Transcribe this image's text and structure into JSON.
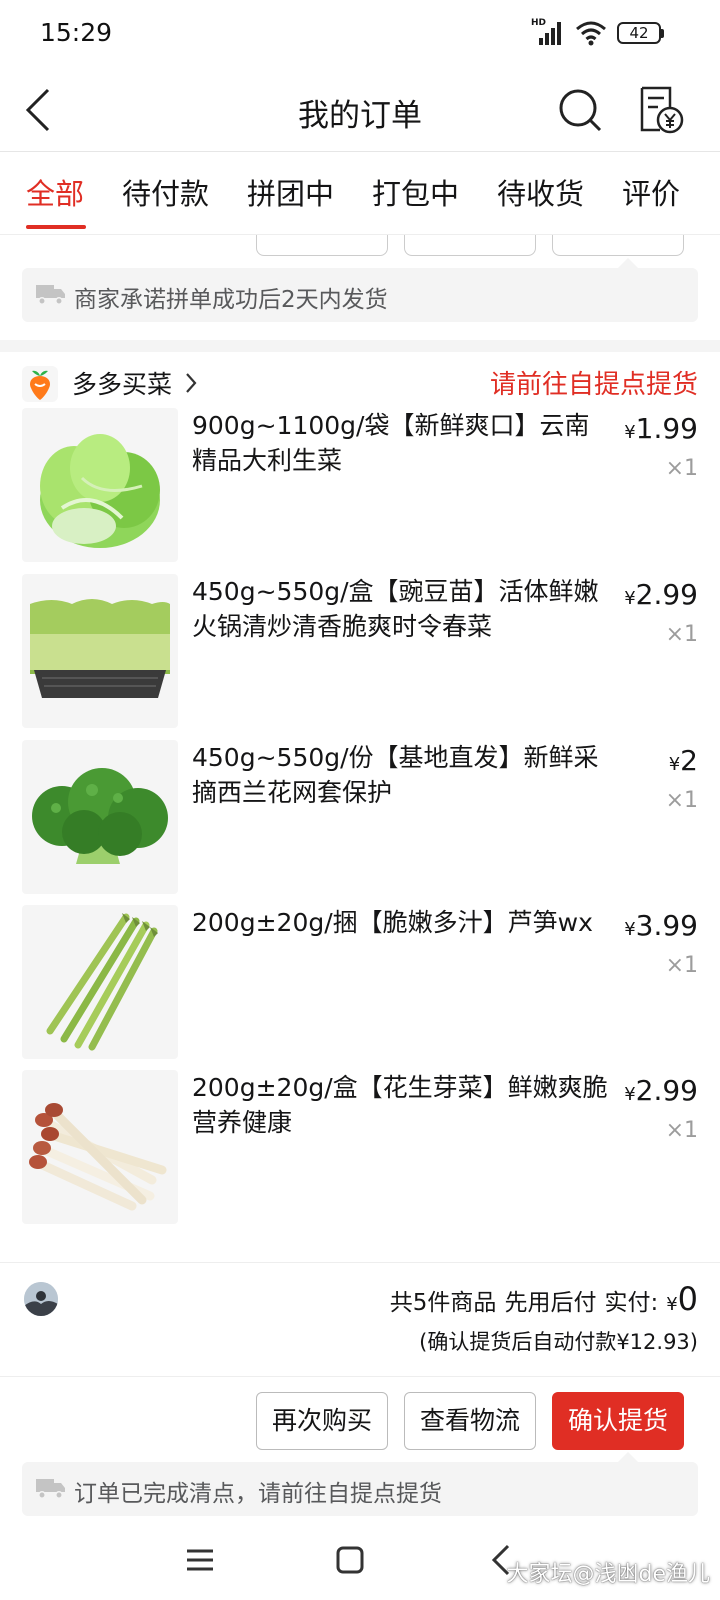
{
  "status_bar": {
    "time": "15:29",
    "network": "HD",
    "battery": "42"
  },
  "nav": {
    "title": "我的订单",
    "back_icon": "back-arrow-icon",
    "search_icon": "search-icon",
    "bill_icon": "bill-yen-icon"
  },
  "tabs": [
    "全部",
    "待付款",
    "拼团中",
    "打包中",
    "待收货",
    "评价"
  ],
  "active_tab": "全部",
  "accent_color": "#e02e24",
  "prev_order": {
    "notice": "商家承诺拼单成功后2天内发货"
  },
  "store": {
    "name": "多多买菜",
    "status": "请前往自提点提货"
  },
  "items": [
    {
      "title": "900g~1100g/袋【新鲜爽口】云南精品大利生菜",
      "currency": "¥",
      "price": "1.99",
      "qty": "×1"
    },
    {
      "title": "450g~550g/盒【豌豆苗】活体鲜嫩火锅清炒清香脆爽时令春菜",
      "currency": "¥",
      "price": "2.99",
      "qty": "×1"
    },
    {
      "title": "450g~550g/份【基地直发】新鲜采摘西兰花网套保护",
      "currency": "¥",
      "price": "2",
      "qty": "×1"
    },
    {
      "title": "200g±20g/捆【脆嫩多汁】芦笋wx",
      "currency": "¥",
      "price": "3.99",
      "qty": "×1"
    },
    {
      "title": "200g±20g/盒【花生芽菜】鲜嫩爽脆 营养健康",
      "currency": "¥",
      "price": "2.99",
      "qty": "×1"
    }
  ],
  "summary": {
    "count_text": "共5件商品",
    "pay_mode": "先用后付",
    "paid_label": "实付:",
    "currency": "¥",
    "paid_value": "0",
    "auto_pay_note": "(确认提货后自动付款¥12.93)"
  },
  "actions": {
    "rebuy": "再次购买",
    "logistics": "查看物流",
    "confirm": "确认提货"
  },
  "bottom_notice": "订单已完成清点，请前往自提点提货",
  "watermark": "大家坛@浅凼de渔儿"
}
